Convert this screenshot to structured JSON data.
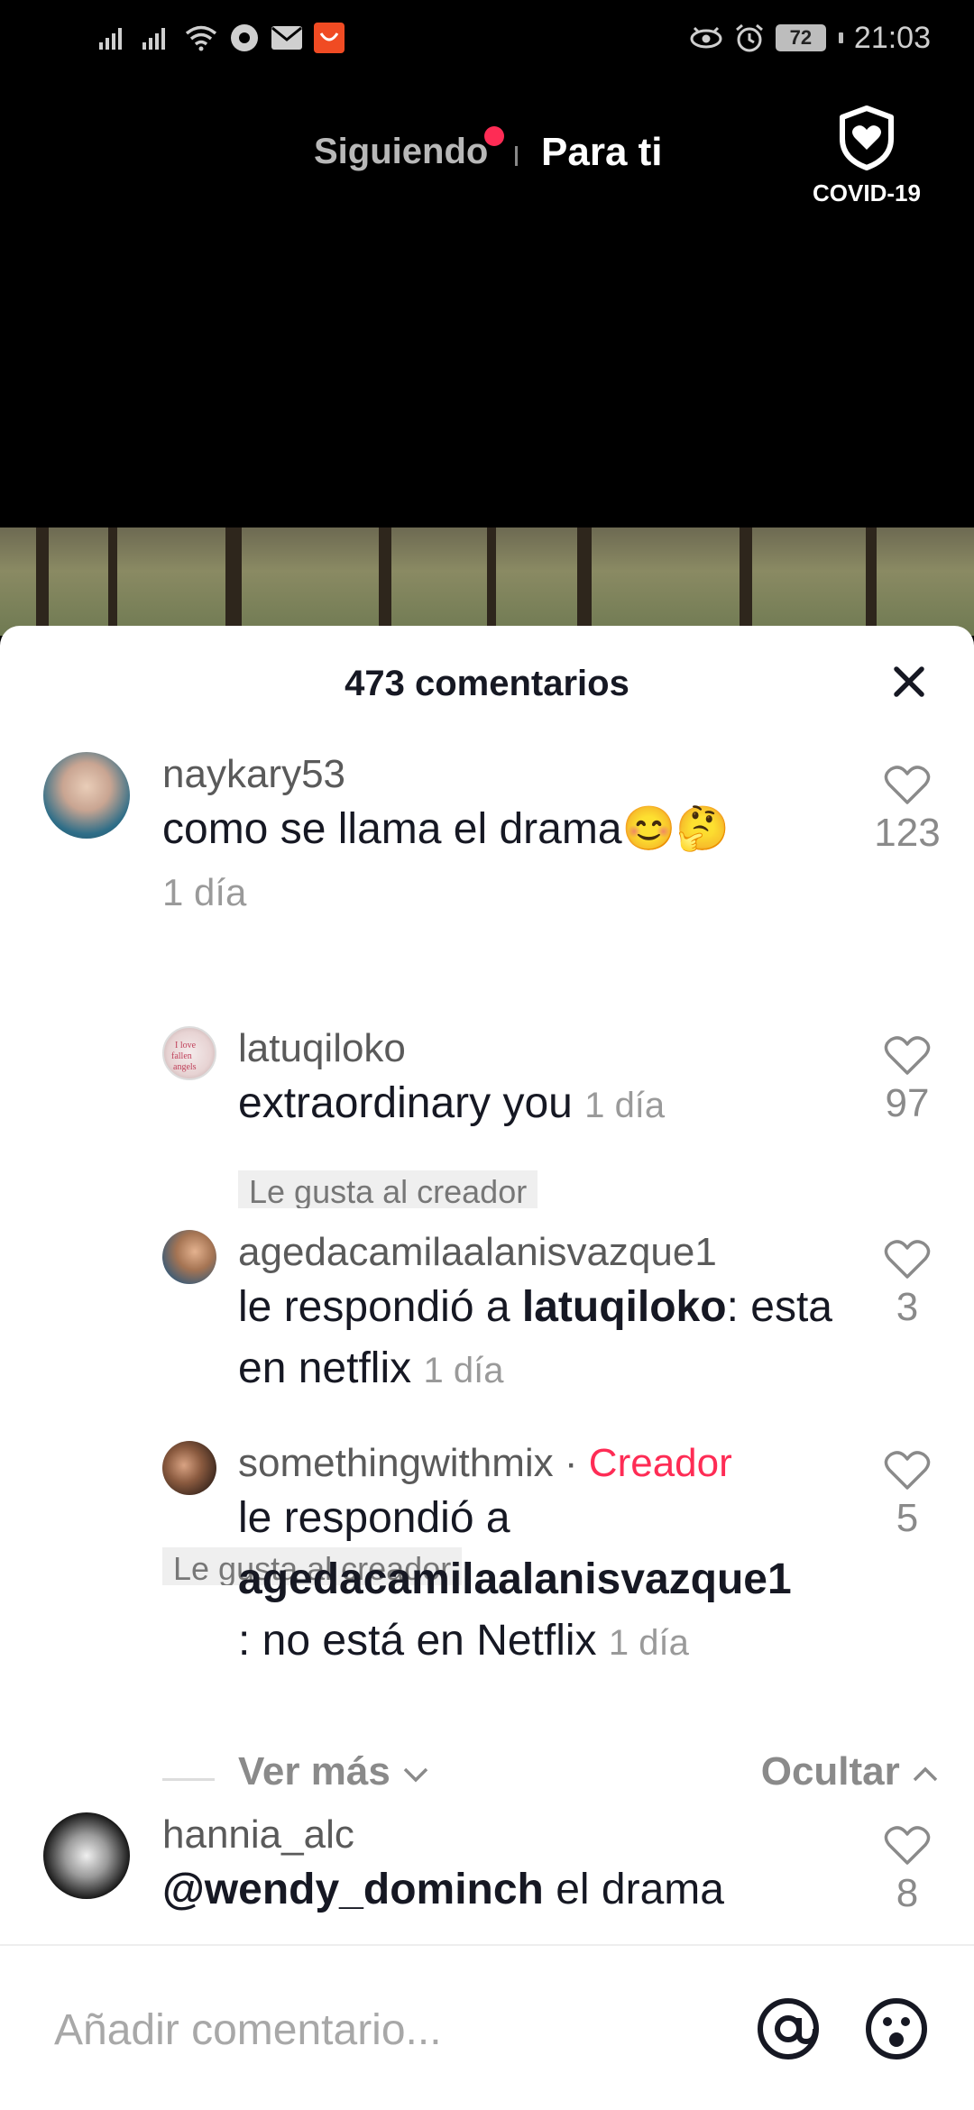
{
  "status_bar": {
    "time": "21:03",
    "battery": "72"
  },
  "top_nav": {
    "following": "Siguiendo",
    "for_you": "Para ti",
    "covid_label": "COVID-19"
  },
  "comments_sheet": {
    "title": "473 comentarios",
    "comments": [
      {
        "username": "naykary53",
        "text": "como se llama el drama😊🤔",
        "time": "1 día",
        "liked_by_creator": "Le gusta al creador",
        "likes": "123"
      },
      {
        "username": "latuqiloko",
        "text": "extraordinary you",
        "time": "1 día",
        "liked_by_creator": "Le gusta al creador",
        "likes": "97"
      },
      {
        "username": "agedacamilaalanisvazque1",
        "reply_prefix": "le respondió a ",
        "reply_to": "latuqiloko",
        "reply_colon": ":",
        "text": "esta en netflix",
        "time": "1 día",
        "likes": "3"
      },
      {
        "username": "somethingwithmix",
        "separator": " · ",
        "creator_tag": "Creador",
        "reply_prefix": "le respondió a",
        "reply_to": "agedacamilaalanisvazque1",
        "text": ": no está en Netflix",
        "time": "1 día",
        "likes": "5"
      },
      {
        "username": "hannia_alc",
        "mention": "@wendy_dominch",
        "text": " el drama",
        "likes": "8"
      }
    ],
    "view_more": "Ver más",
    "hide": "Ocultar"
  },
  "input": {
    "placeholder": "Añadir comentario..."
  },
  "colors": {
    "accent": "#fe2c55",
    "background_dark": "#000000",
    "sheet_bg": "#ffffff"
  }
}
